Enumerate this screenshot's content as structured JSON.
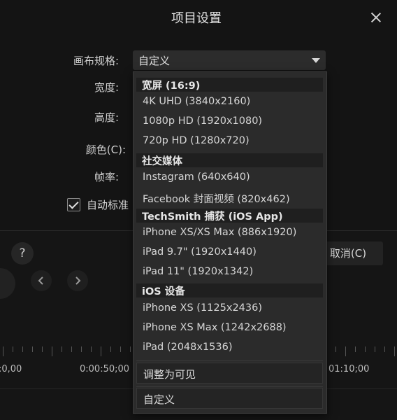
{
  "dialog": {
    "title": "项目设置",
    "labels": {
      "canvas": "画布规格:",
      "width": "宽度:",
      "height": "高度:",
      "color": "颜色(C):",
      "framerate": "帧率:"
    },
    "select_value": "自定义",
    "auto_label": "自动标准",
    "help_label": "?",
    "cancel_label": "取消(C)"
  },
  "timeline": {
    "time_labels": [
      ":0,00",
      "0:00:50;00",
      "01:10;00"
    ]
  },
  "dropdown": {
    "groups": [
      {
        "header": "宽屏 (16:9)",
        "items": [
          "4K UHD (3840x2160)",
          "1080p HD (1920x1080)",
          "720p HD (1280x720)"
        ]
      },
      {
        "header": "社交媒体",
        "items": [
          "Instagram (640x640)",
          "Facebook 封面视频 (820x462)"
        ]
      },
      {
        "header": "TechSmith 捕获 (iOS App)",
        "items": [
          "iPhone XS/XS Max (886x1920)",
          "iPad 9.7\" (1920x1440)",
          "iPad 11\" (1920x1342)"
        ]
      },
      {
        "header": "iOS 设备",
        "items": [
          "iPhone XS (1125x2436)",
          "iPhone XS Max (1242x2688)",
          "iPad (2048x1536)"
        ]
      }
    ],
    "fit_label": "调整为可见",
    "custom_label": "自定义"
  },
  "colors": {
    "background": "#151515",
    "dropdown_bg": "#2b2b2b",
    "group_header_bg": "#1f1f1f",
    "accent_green": "#29b34a"
  }
}
